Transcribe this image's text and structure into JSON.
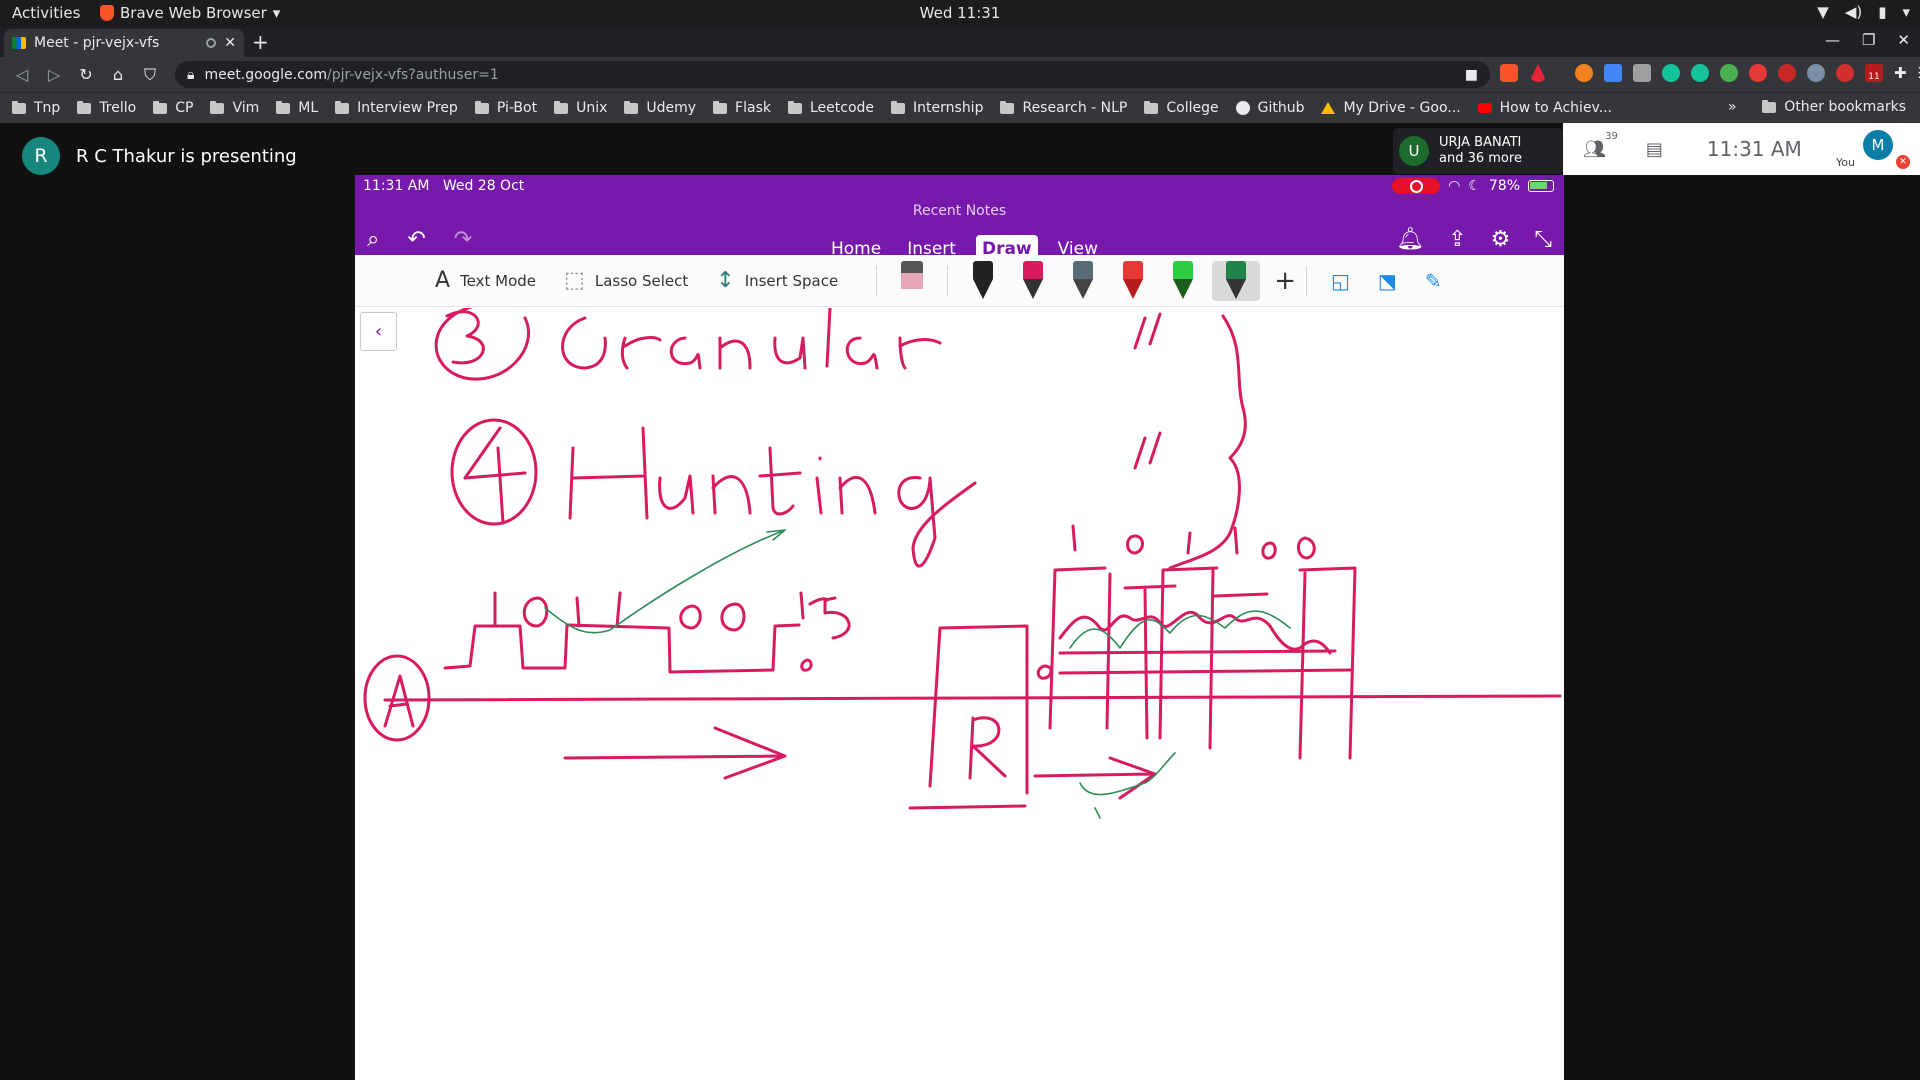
{
  "gnome": {
    "activities": "Activities",
    "app_name": "Brave Web Browser",
    "clock": "Wed 11:31"
  },
  "browser": {
    "tab_title": "Meet - pjr-vejx-vfs",
    "url_host": "meet.google.com",
    "url_path": "/pjr-vejx-vfs?authuser=1",
    "bookmarks": [
      "Tnp",
      "Trello",
      "CP",
      "Vim",
      "ML",
      "Interview Prep",
      "Pi-Bot",
      "Unix",
      "Udemy",
      "Flask",
      "Leetcode",
      "Internship",
      "Research - NLP",
      "College"
    ],
    "bookmark_github": "Github",
    "bookmark_drive": "My Drive - Goo...",
    "bookmark_youtube": "How to Achiev...",
    "bookmark_other": "Other bookmarks",
    "more": "»",
    "extension_badge": "11"
  },
  "meet": {
    "presenter_initial": "R",
    "presenter_text": "R C Thakur is presenting",
    "participant_initial": "U",
    "participant_name": "URJA BANATI",
    "participant_more": "and 36 more",
    "people_count": "39",
    "time": "11:31  AM",
    "self_initial": "M",
    "self_label": "You"
  },
  "onenote": {
    "status_time": "11:31 AM",
    "status_date": "Wed 28 Oct",
    "battery": "78%",
    "recent_notes": "Recent Notes",
    "tabs": [
      "Home",
      "Insert",
      "Draw",
      "View"
    ],
    "active_tab": "Draw",
    "ribbon": {
      "text_mode": "Text Mode",
      "lasso_select": "Lasso Select",
      "insert_space": "Insert Space"
    },
    "pen_colors": [
      "#e8a7b8",
      "#222222",
      "#d81b60",
      "#5a6b78",
      "#e53935",
      "#2ecc40",
      "#1e8449"
    ],
    "ink_color": "#d81b60",
    "green_ink": "#2e8b57",
    "handwriting": {
      "item3": "3",
      "item3_word": "Granular",
      "item4": "4",
      "item4_word": "Hunting",
      "bits_left": "1 0 1 1 0 0 1",
      "bits_right": "1 0 1 1 0 0",
      "label_a": "A",
      "label_r": "R",
      "value_5": "5"
    }
  }
}
